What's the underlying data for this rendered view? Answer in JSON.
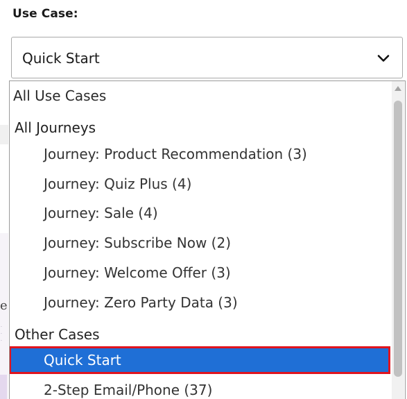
{
  "field": {
    "label": "Use Case:",
    "selected_value": "Quick Start"
  },
  "dropdown": {
    "options": [
      {
        "label": "All Use Cases",
        "kind": "option"
      },
      {
        "label": "All Journeys",
        "kind": "group"
      },
      {
        "label": "Journey: Product Recommendation (3)",
        "kind": "option"
      },
      {
        "label": "Journey: Quiz Plus (4)",
        "kind": "option"
      },
      {
        "label": "Journey: Sale (4)",
        "kind": "option"
      },
      {
        "label": "Journey: Subscribe Now (2)",
        "kind": "option"
      },
      {
        "label": "Journey: Welcome Offer (3)",
        "kind": "option"
      },
      {
        "label": "Journey: Zero Party Data (3)",
        "kind": "option"
      },
      {
        "label": "Other Cases",
        "kind": "group"
      },
      {
        "label": "Quick Start",
        "kind": "option",
        "selected": true
      },
      {
        "label": "2-Step Email/Phone (37)",
        "kind": "option"
      }
    ]
  },
  "background": {
    "glyph": "e"
  },
  "icons": {
    "chevron": "chevron-down-icon",
    "scroll_up": "scroll-up-arrow-icon"
  },
  "colors": {
    "selected_background": "#1f6fd6",
    "highlight_outline": "#e0141e",
    "border": "#a9a9a9"
  }
}
